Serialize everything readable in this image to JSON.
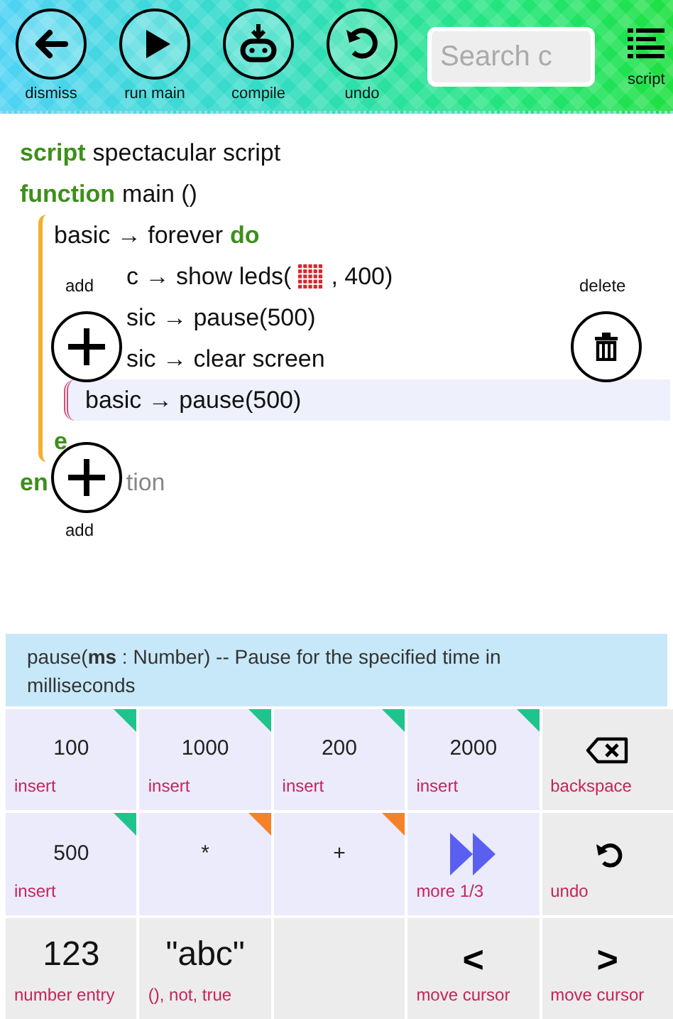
{
  "toolbar": {
    "buttons": [
      {
        "kind": "back",
        "label": "dismiss"
      },
      {
        "kind": "run",
        "label": "run main"
      },
      {
        "kind": "compile",
        "label": "compile"
      },
      {
        "kind": "undo",
        "label": "undo"
      }
    ],
    "search": {
      "placeholder": "Search c"
    },
    "script_button": {
      "label": "script"
    }
  },
  "code": [
    {
      "tokens": [
        {
          "kind": "keyword",
          "text": "script"
        },
        {
          "kind": "text",
          "text": "spectacular script"
        }
      ]
    },
    {
      "tokens": [
        {
          "kind": "keyword",
          "text": "function"
        },
        {
          "kind": "text",
          "text": "main ()"
        }
      ],
      "children": [
        {
          "tokens": [
            {
              "kind": "text",
              "text": "basic → forever"
            },
            {
              "kind": "keyword",
              "text": "do"
            }
          ],
          "children": [
            {
              "covered": true,
              "selected": false,
              "tokens": [
                {
                  "kind": "text",
                  "text": "c → show leds("
                },
                {
                  "kind": "leds"
                },
                {
                  "kind": "text",
                  "text": ", 400)"
                }
              ]
            },
            {
              "covered": true,
              "selected": false,
              "tokens": [
                {
                  "kind": "text",
                  "text": "sic → pause(500)"
                }
              ]
            },
            {
              "covered": true,
              "selected": false,
              "tokens": [
                {
                  "kind": "text",
                  "text": "sic → clear screen"
                }
              ]
            },
            {
              "covered": false,
              "selected": true,
              "tokens": [
                {
                  "kind": "text",
                  "text": "basic → pause(500)"
                }
              ]
            }
          ],
          "end": [
            {
              "kind": "keyword",
              "text": "e"
            }
          ]
        }
      ]
    },
    {
      "tokens": [
        {
          "kind": "keyword",
          "text": "en"
        },
        {
          "kind": "muted",
          "text": "tion"
        }
      ]
    }
  ],
  "add_buttons": [
    {
      "label": "add"
    },
    {
      "label": "add"
    }
  ],
  "delete_button": {
    "label": "delete"
  },
  "help": "pause(**ms** : Number) -- Pause for the specified time in milliseconds",
  "keys": [
    {
      "kind": "value",
      "label": "100",
      "caption": "insert",
      "highlighted": true,
      "color": "#1fc48c"
    },
    {
      "kind": "value",
      "label": "1000",
      "caption": "insert",
      "highlighted": true,
      "color": "#1fc48c"
    },
    {
      "kind": "value",
      "label": "200",
      "caption": "insert",
      "highlighted": true,
      "color": "#1fc48c"
    },
    {
      "kind": "value",
      "label": "2000",
      "caption": "insert",
      "highlighted": true,
      "color": "#1fc48c"
    },
    {
      "kind": "backspace",
      "caption": "backspace",
      "highlighted": false
    },
    {
      "kind": "value",
      "label": "500",
      "caption": "insert",
      "highlighted": true,
      "color": "#1fc48c"
    },
    {
      "kind": "value",
      "label": "*",
      "highlighted": true,
      "color": "#f5822a"
    },
    {
      "kind": "value",
      "label": "+",
      "highlighted": true,
      "color": "#f5822a"
    },
    {
      "kind": "more",
      "caption": "more 1/3",
      "highlighted": true
    },
    {
      "kind": "undo",
      "caption": "undo",
      "highlighted": false
    },
    {
      "kind": "entry",
      "label": "123",
      "caption": "number entry",
      "highlighted": false
    },
    {
      "kind": "entry",
      "label": "\"abc\"",
      "caption": "(), not, true",
      "highlighted": false
    },
    {
      "kind": "blank",
      "highlighted": false
    },
    {
      "kind": "cursor",
      "label": "<",
      "caption": "move cursor",
      "highlighted": false
    },
    {
      "kind": "cursor",
      "label": ">",
      "caption": "move cursor",
      "highlighted": false
    }
  ]
}
